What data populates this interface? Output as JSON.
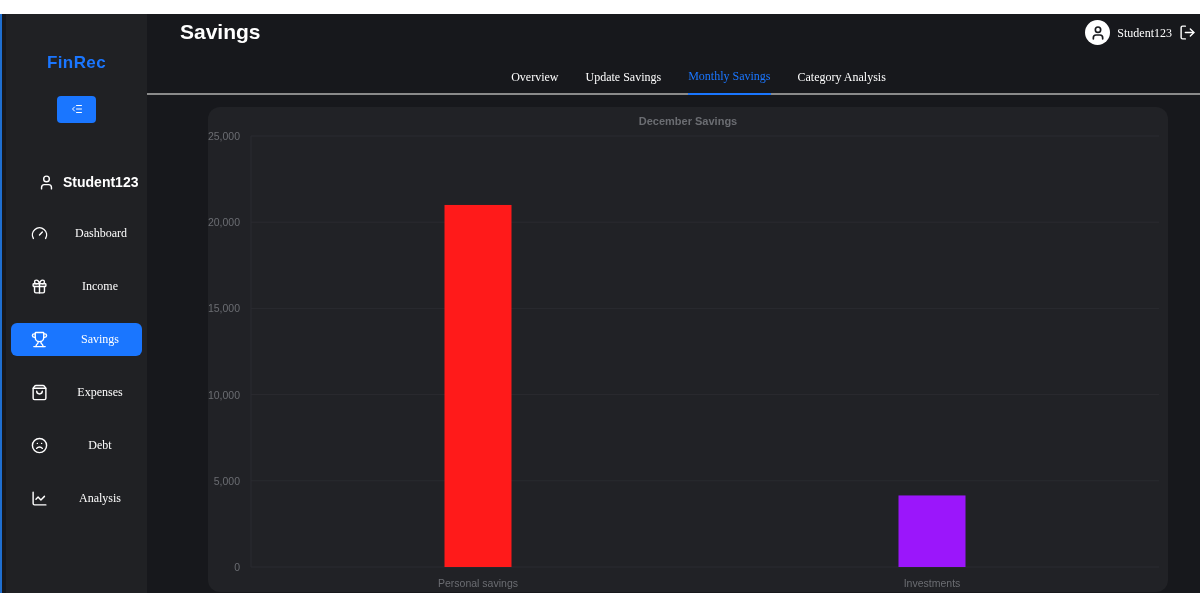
{
  "app": {
    "logo": "FinRec"
  },
  "sidebar": {
    "user": "Student123",
    "items": [
      {
        "label": "Dashboard",
        "selected": false
      },
      {
        "label": "Income",
        "selected": false
      },
      {
        "label": "Savings",
        "selected": true
      },
      {
        "label": "Expenses",
        "selected": false
      },
      {
        "label": "Debt",
        "selected": false
      },
      {
        "label": "Analysis",
        "selected": false
      }
    ]
  },
  "header": {
    "title": "Savings",
    "user": "Student123"
  },
  "tabs": [
    {
      "label": "Overview",
      "selected": false
    },
    {
      "label": "Update Savings",
      "selected": false
    },
    {
      "label": "Monthly Savings",
      "selected": true
    },
    {
      "label": "Category Analysis",
      "selected": false
    }
  ],
  "chart": {
    "chart_data": {
      "type": "bar",
      "title": "December Savings",
      "categories": [
        "Personal savings",
        "Investments"
      ],
      "series": [
        {
          "color": "#ff1a1a",
          "values": [
            21000,
            null
          ]
        },
        {
          "color": "#9b16fb",
          "values": [
            null,
            4150
          ]
        }
      ],
      "stacked": true,
      "grid": true,
      "ylim": [
        0,
        25000
      ],
      "yticks": [
        {
          "value": 0,
          "label": "0"
        },
        {
          "value": 5000,
          "label": "5,000"
        },
        {
          "value": 10000,
          "label": "10,000"
        },
        {
          "value": 15000,
          "label": "15,000"
        },
        {
          "value": 20000,
          "label": "20,000"
        },
        {
          "value": 25000,
          "label": "25,000"
        }
      ]
    }
  }
}
